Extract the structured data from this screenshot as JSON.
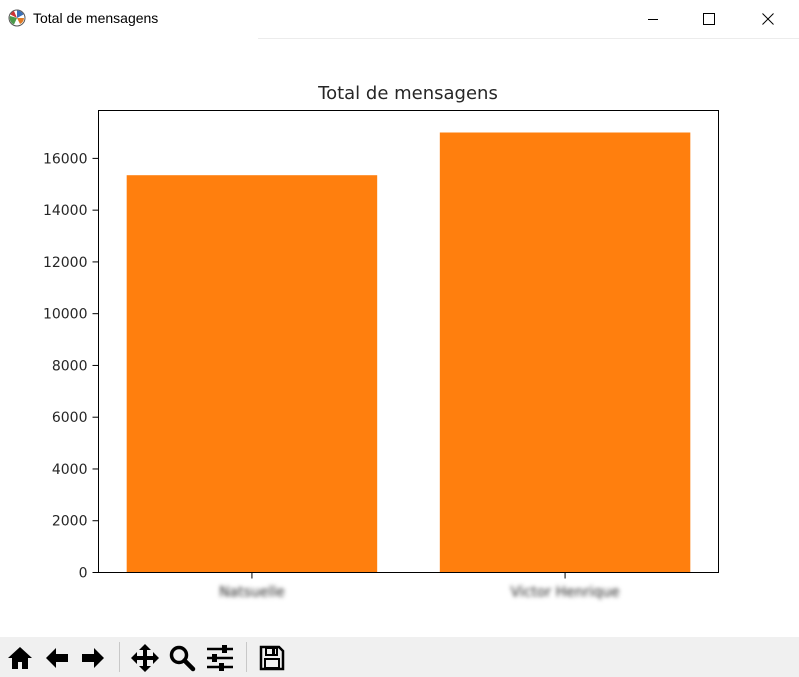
{
  "window": {
    "title": "Total de mensagens",
    "controls": [
      "minimize-icon",
      "maximize-icon",
      "close-icon"
    ]
  },
  "toolbar": {
    "buttons": [
      "home-icon",
      "back-arrow-icon",
      "forward-arrow-icon",
      "pan-icon",
      "zoom-icon",
      "configure-subplots-icon",
      "save-icon"
    ]
  },
  "chart_data": {
    "type": "bar",
    "title": "Total de mensagens",
    "categories": [
      "Natsuelle",
      "Victor Henrique"
    ],
    "values": [
      15350,
      17000
    ],
    "ylim": [
      0,
      17850
    ],
    "yticks": [
      0,
      2000,
      4000,
      6000,
      8000,
      10000,
      12000,
      14000,
      16000
    ],
    "bar_color": "#ff7f0e",
    "grid": false,
    "legend": "none",
    "xlabel": "",
    "ylabel": ""
  }
}
